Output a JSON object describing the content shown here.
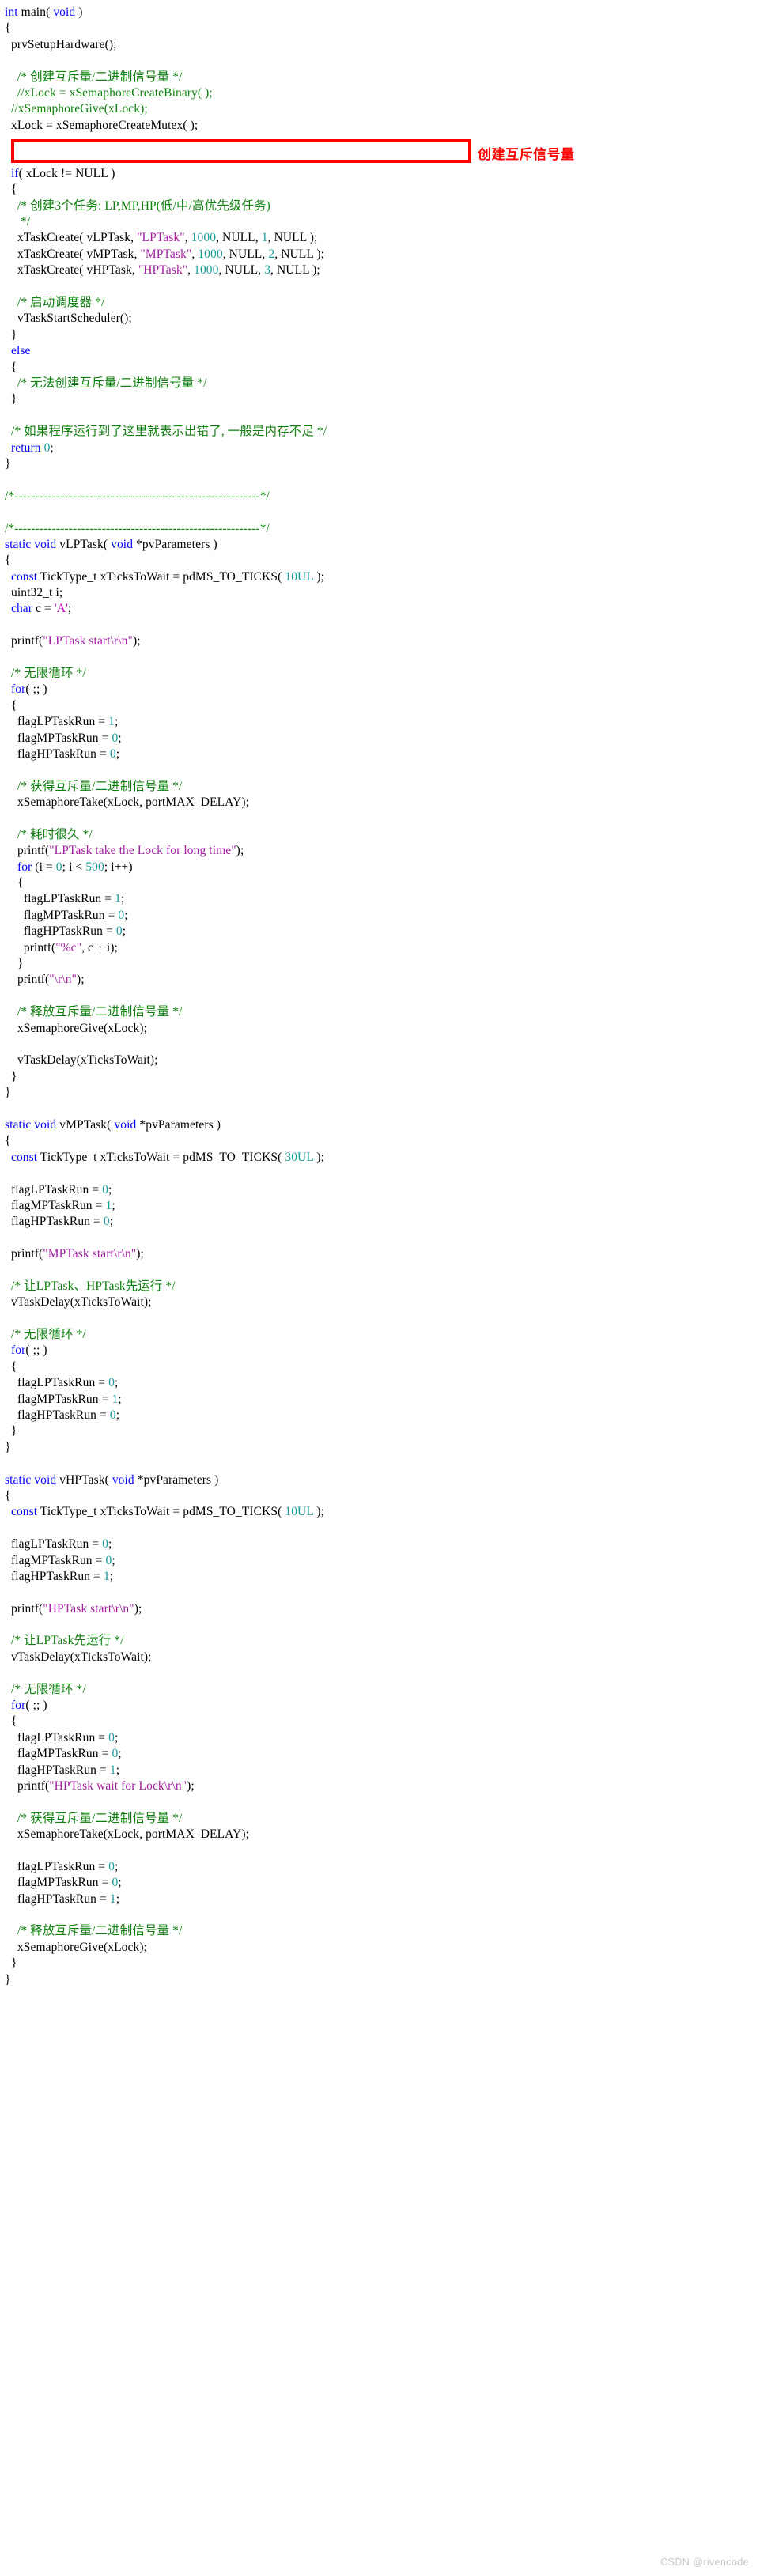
{
  "annotation": {
    "mutex_label": "创建互斥信号量"
  },
  "watermark": {
    "text": "CSDN @rivencode"
  },
  "colors": {
    "keyword": "#0000ff",
    "comment": "#108010",
    "string": "#a020a0",
    "number": "#1a9a9a",
    "plain": "#000000",
    "annotation_red": "#ff0000",
    "watermark_gray": "#c8c8c8",
    "background": "#ffffff"
  },
  "code": {
    "language": "c",
    "lines": [
      {
        "i": 1,
        "text": "int main( void )"
      },
      {
        "i": 2,
        "text": "{"
      },
      {
        "i": 3,
        "text": "  prvSetupHardware();"
      },
      {
        "i": 4,
        "text": ""
      },
      {
        "i": 5,
        "text": "    /* 创建互斥量/二进制信号量 */"
      },
      {
        "i": 6,
        "text": "    //xLock = xSemaphoreCreateBinary( );"
      },
      {
        "i": 7,
        "text": "  //xSemaphoreGive(xLock);"
      },
      {
        "i": 8,
        "text": "  xLock = xSemaphoreCreateMutex( );"
      },
      {
        "i": 9,
        "text": ""
      },
      {
        "i": 10,
        "text": ""
      },
      {
        "i": 11,
        "text": "  if( xLock != NULL )"
      },
      {
        "i": 12,
        "text": "  {"
      },
      {
        "i": 13,
        "text": "    /* 创建3个任务: LP,MP,HP(低/中/高优先级任务)"
      },
      {
        "i": 14,
        "text": "     */"
      },
      {
        "i": 15,
        "text": "    xTaskCreate( vLPTask, \"LPTask\", 1000, NULL, 1, NULL );"
      },
      {
        "i": 16,
        "text": "    xTaskCreate( vMPTask, \"MPTask\", 1000, NULL, 2, NULL );"
      },
      {
        "i": 17,
        "text": "    xTaskCreate( vHPTask, \"HPTask\", 1000, NULL, 3, NULL );"
      },
      {
        "i": 18,
        "text": ""
      },
      {
        "i": 19,
        "text": "    /* 启动调度器 */"
      },
      {
        "i": 20,
        "text": "    vTaskStartScheduler();"
      },
      {
        "i": 21,
        "text": "  }"
      },
      {
        "i": 22,
        "text": "  else"
      },
      {
        "i": 23,
        "text": "  {"
      },
      {
        "i": 24,
        "text": "    /* 无法创建互斥量/二进制信号量 */"
      },
      {
        "i": 25,
        "text": "  }"
      },
      {
        "i": 26,
        "text": ""
      },
      {
        "i": 27,
        "text": "  /* 如果程序运行到了这里就表示出错了, 一般是内存不足 */"
      },
      {
        "i": 28,
        "text": "  return 0;"
      },
      {
        "i": 29,
        "text": "}"
      },
      {
        "i": 30,
        "text": ""
      },
      {
        "i": 31,
        "text": "/*-----------------------------------------------------------*/"
      },
      {
        "i": 32,
        "text": ""
      },
      {
        "i": 33,
        "text": "/*-----------------------------------------------------------*/"
      },
      {
        "i": 34,
        "text": "static void vLPTask( void *pvParameters )"
      },
      {
        "i": 35,
        "text": "{"
      },
      {
        "i": 36,
        "text": "  const TickType_t xTicksToWait = pdMS_TO_TICKS( 10UL );"
      },
      {
        "i": 37,
        "text": "  uint32_t i;"
      },
      {
        "i": 38,
        "text": "  char c = 'A';"
      },
      {
        "i": 39,
        "text": ""
      },
      {
        "i": 40,
        "text": "  printf(\"LPTask start\\r\\n\");"
      },
      {
        "i": 41,
        "text": ""
      },
      {
        "i": 42,
        "text": "  /* 无限循环 */"
      },
      {
        "i": 43,
        "text": "  for( ;; )"
      },
      {
        "i": 44,
        "text": "  {"
      },
      {
        "i": 45,
        "text": "    flagLPTaskRun = 1;"
      },
      {
        "i": 46,
        "text": "    flagMPTaskRun = 0;"
      },
      {
        "i": 47,
        "text": "    flagHPTaskRun = 0;"
      },
      {
        "i": 48,
        "text": ""
      },
      {
        "i": 49,
        "text": "    /* 获得互斥量/二进制信号量 */"
      },
      {
        "i": 50,
        "text": "    xSemaphoreTake(xLock, portMAX_DELAY);"
      },
      {
        "i": 51,
        "text": ""
      },
      {
        "i": 52,
        "text": "    /* 耗时很久 */"
      },
      {
        "i": 53,
        "text": "    printf(\"LPTask take the Lock for long time\");"
      },
      {
        "i": 54,
        "text": "    for (i = 0; i < 500; i++)"
      },
      {
        "i": 55,
        "text": "    {"
      },
      {
        "i": 56,
        "text": "      flagLPTaskRun = 1;"
      },
      {
        "i": 57,
        "text": "      flagMPTaskRun = 0;"
      },
      {
        "i": 58,
        "text": "      flagHPTaskRun = 0;"
      },
      {
        "i": 59,
        "text": "      printf(\"%c\", c + i);"
      },
      {
        "i": 60,
        "text": "    }"
      },
      {
        "i": 61,
        "text": "    printf(\"\\r\\n\");"
      },
      {
        "i": 62,
        "text": ""
      },
      {
        "i": 63,
        "text": "    /* 释放互斥量/二进制信号量 */"
      },
      {
        "i": 64,
        "text": "    xSemaphoreGive(xLock);"
      },
      {
        "i": 65,
        "text": ""
      },
      {
        "i": 66,
        "text": "    vTaskDelay(xTicksToWait);"
      },
      {
        "i": 67,
        "text": "  }"
      },
      {
        "i": 68,
        "text": "}"
      },
      {
        "i": 69,
        "text": ""
      },
      {
        "i": 70,
        "text": "static void vMPTask( void *pvParameters )"
      },
      {
        "i": 71,
        "text": "{"
      },
      {
        "i": 72,
        "text": "  const TickType_t xTicksToWait = pdMS_TO_TICKS( 30UL );"
      },
      {
        "i": 73,
        "text": ""
      },
      {
        "i": 74,
        "text": "  flagLPTaskRun = 0;"
      },
      {
        "i": 75,
        "text": "  flagMPTaskRun = 1;"
      },
      {
        "i": 76,
        "text": "  flagHPTaskRun = 0;"
      },
      {
        "i": 77,
        "text": ""
      },
      {
        "i": 78,
        "text": "  printf(\"MPTask start\\r\\n\");"
      },
      {
        "i": 79,
        "text": ""
      },
      {
        "i": 80,
        "text": "  /* 让LPTask、HPTask先运行 */"
      },
      {
        "i": 81,
        "text": "  vTaskDelay(xTicksToWait);"
      },
      {
        "i": 82,
        "text": ""
      },
      {
        "i": 83,
        "text": "  /* 无限循环 */"
      },
      {
        "i": 84,
        "text": "  for( ;; )"
      },
      {
        "i": 85,
        "text": "  {"
      },
      {
        "i": 86,
        "text": "    flagLPTaskRun = 0;"
      },
      {
        "i": 87,
        "text": "    flagMPTaskRun = 1;"
      },
      {
        "i": 88,
        "text": "    flagHPTaskRun = 0;"
      },
      {
        "i": 89,
        "text": "  }"
      },
      {
        "i": 90,
        "text": "}"
      },
      {
        "i": 91,
        "text": ""
      },
      {
        "i": 92,
        "text": "static void vHPTask( void *pvParameters )"
      },
      {
        "i": 93,
        "text": "{"
      },
      {
        "i": 94,
        "text": "  const TickType_t xTicksToWait = pdMS_TO_TICKS( 10UL );"
      },
      {
        "i": 95,
        "text": ""
      },
      {
        "i": 96,
        "text": "  flagLPTaskRun = 0;"
      },
      {
        "i": 97,
        "text": "  flagMPTaskRun = 0;"
      },
      {
        "i": 98,
        "text": "  flagHPTaskRun = 1;"
      },
      {
        "i": 99,
        "text": ""
      },
      {
        "i": 100,
        "text": "  printf(\"HPTask start\\r\\n\");"
      },
      {
        "i": 101,
        "text": ""
      },
      {
        "i": 102,
        "text": "  /* 让LPTask先运行 */"
      },
      {
        "i": 103,
        "text": "  vTaskDelay(xTicksToWait);"
      },
      {
        "i": 104,
        "text": ""
      },
      {
        "i": 105,
        "text": "  /* 无限循环 */"
      },
      {
        "i": 106,
        "text": "  for( ;; )"
      },
      {
        "i": 107,
        "text": "  {"
      },
      {
        "i": 108,
        "text": "    flagLPTaskRun = 0;"
      },
      {
        "i": 109,
        "text": "    flagMPTaskRun = 0;"
      },
      {
        "i": 110,
        "text": "    flagHPTaskRun = 1;"
      },
      {
        "i": 111,
        "text": "    printf(\"HPTask wait for Lock\\r\\n\");"
      },
      {
        "i": 112,
        "text": ""
      },
      {
        "i": 113,
        "text": "    /* 获得互斥量/二进制信号量 */"
      },
      {
        "i": 114,
        "text": "    xSemaphoreTake(xLock, portMAX_DELAY);"
      },
      {
        "i": 115,
        "text": ""
      },
      {
        "i": 116,
        "text": "    flagLPTaskRun = 0;"
      },
      {
        "i": 117,
        "text": "    flagMPTaskRun = 0;"
      },
      {
        "i": 118,
        "text": "    flagHPTaskRun = 1;"
      },
      {
        "i": 119,
        "text": ""
      },
      {
        "i": 120,
        "text": "    /* 释放互斥量/二进制信号量 */"
      },
      {
        "i": 121,
        "text": "    xSemaphoreGive(xLock);"
      },
      {
        "i": 122,
        "text": "  }"
      },
      {
        "i": 123,
        "text": "}"
      }
    ]
  }
}
